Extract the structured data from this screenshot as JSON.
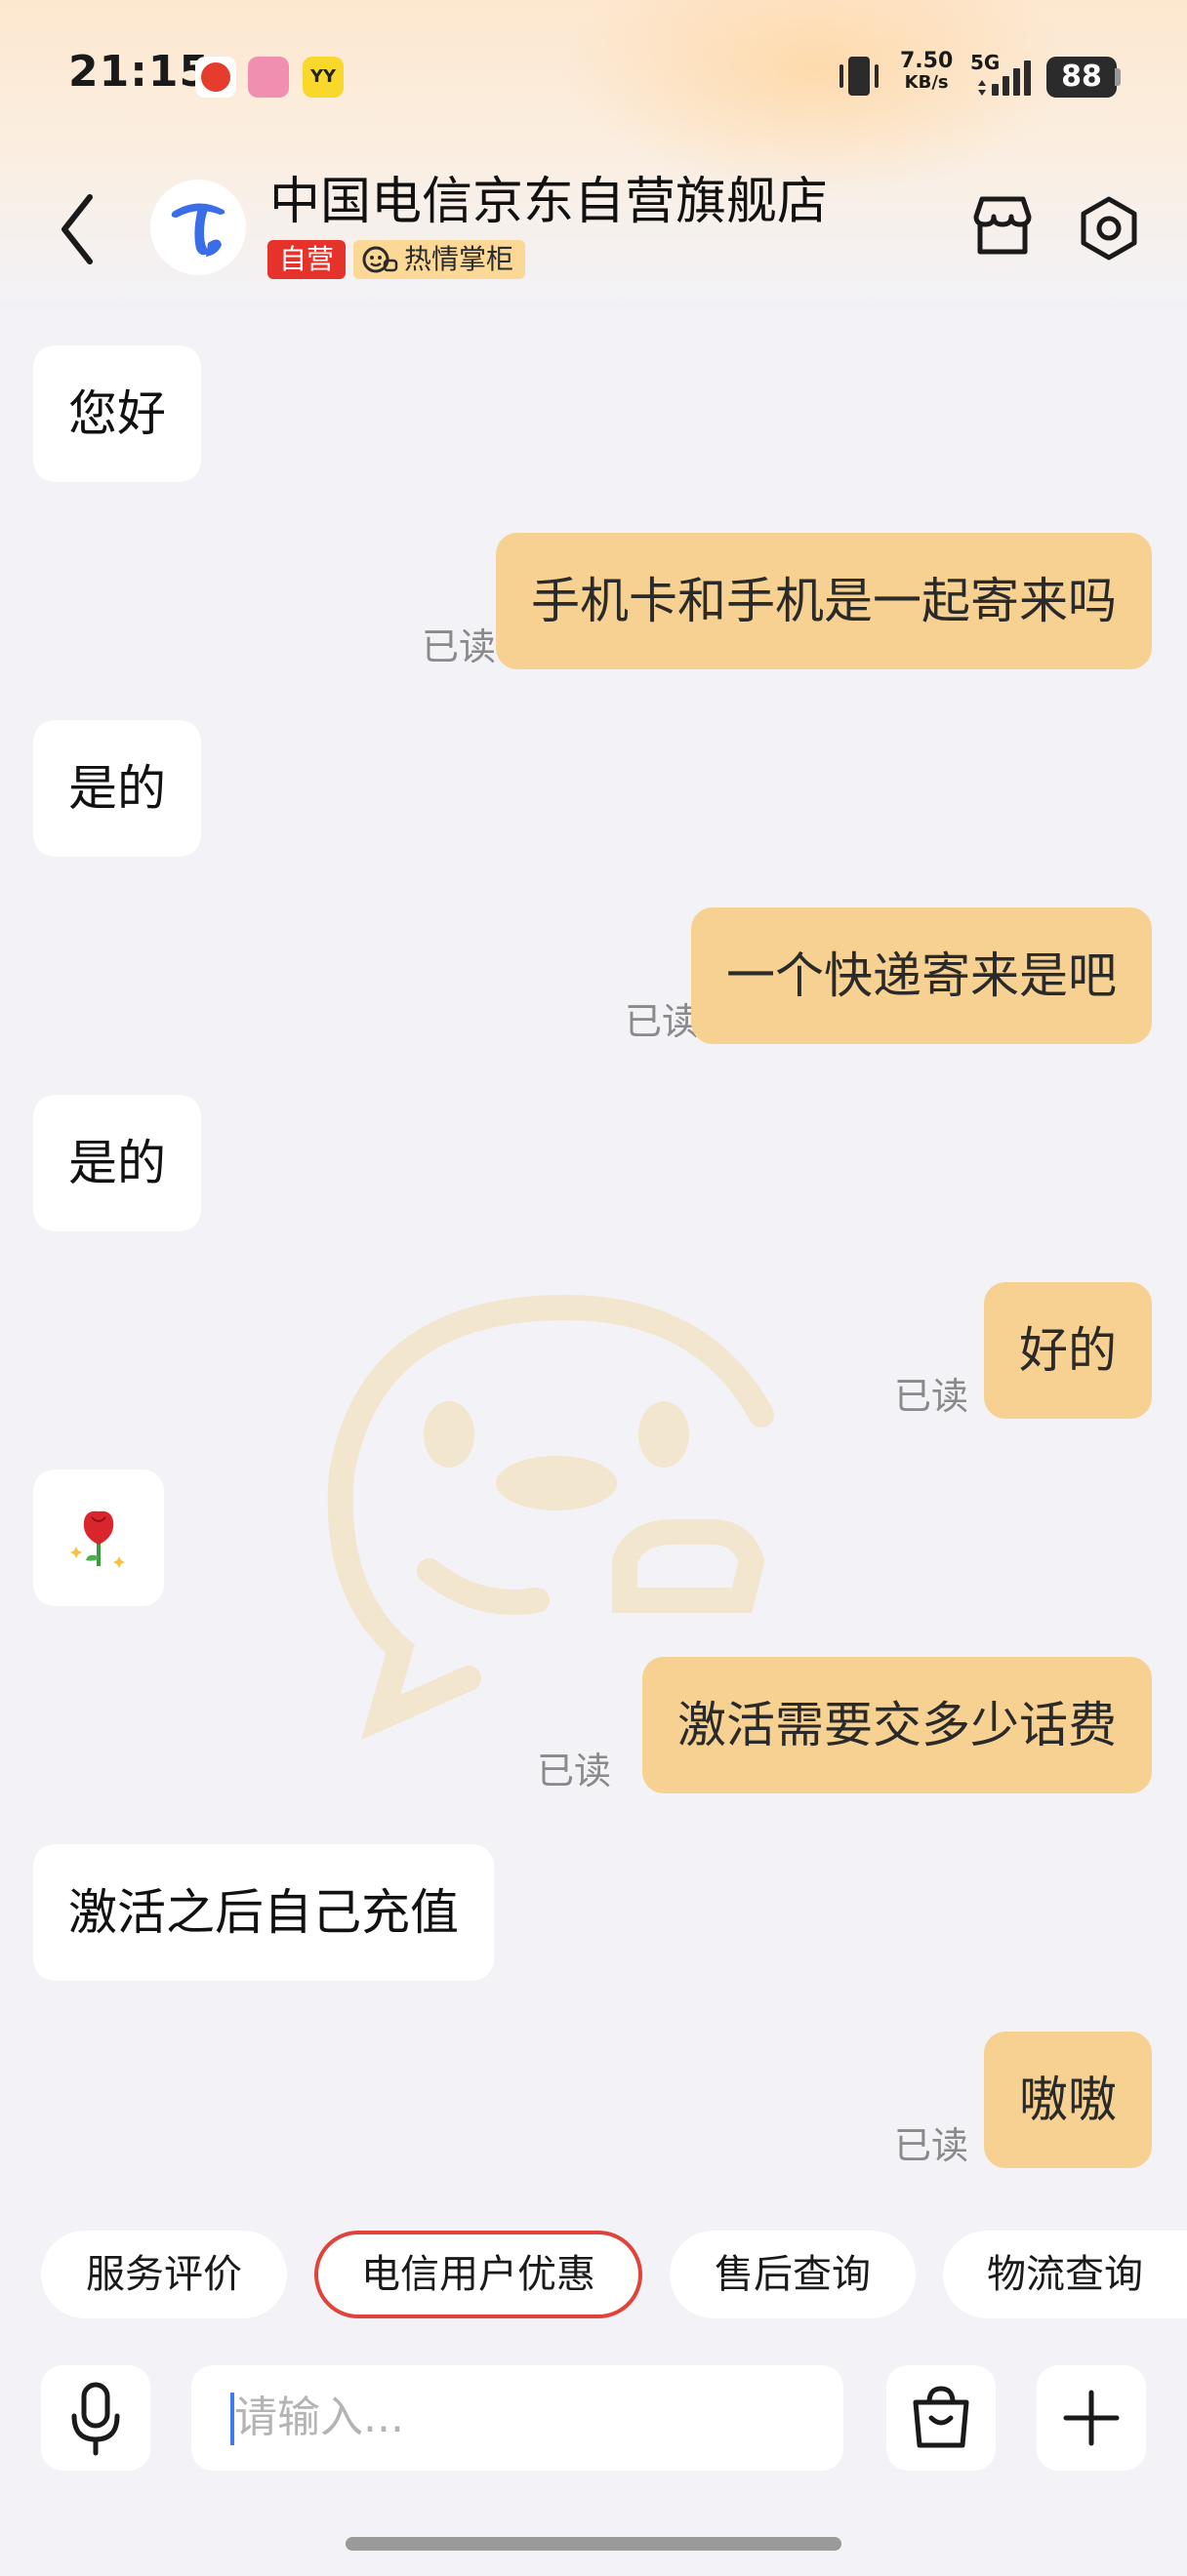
{
  "status_bar": {
    "time": "21:15",
    "net_speed_value": "7.50",
    "net_speed_unit": "KB/s",
    "net_type": "5G",
    "battery": "88",
    "app_icons": [
      "taobao-icon",
      "618-app-icon",
      "yy-icon"
    ],
    "yy_label": "YY"
  },
  "header": {
    "shop_name": "中国电信京东自营旗舰店",
    "badge_self": "自营",
    "badge_host": "热情掌柜",
    "accent_color": "#e5332b"
  },
  "messages": [
    {
      "side": "in",
      "text": "您好"
    },
    {
      "side": "out",
      "text": "手机卡和手机是一起寄来吗",
      "read": "已读"
    },
    {
      "side": "in",
      "text": "是的"
    },
    {
      "side": "out",
      "text": "一个快递寄来是吧",
      "read": "已读"
    },
    {
      "side": "in",
      "text": "是的"
    },
    {
      "side": "out",
      "text": "好的",
      "read": "已读"
    },
    {
      "side": "in",
      "emoji": "rose-emoji"
    },
    {
      "side": "out",
      "text": "激活需要交多少话费",
      "read": "已读"
    },
    {
      "side": "in",
      "text": "激活之后自己充值"
    },
    {
      "side": "out",
      "text": "嗷嗷",
      "read": "已读"
    }
  ],
  "quick_replies": [
    {
      "label": "服务评价",
      "active": false
    },
    {
      "label": "电信用户优惠",
      "active": true
    },
    {
      "label": "售后查询",
      "active": false
    },
    {
      "label": "物流查询",
      "active": false
    }
  ],
  "input": {
    "placeholder": "请输入..."
  },
  "colors": {
    "outgoing_bubble": "#f6d191",
    "incoming_bubble": "#ffffff",
    "background": "#f2f2f7",
    "active_chip_border": "#e0433a"
  }
}
